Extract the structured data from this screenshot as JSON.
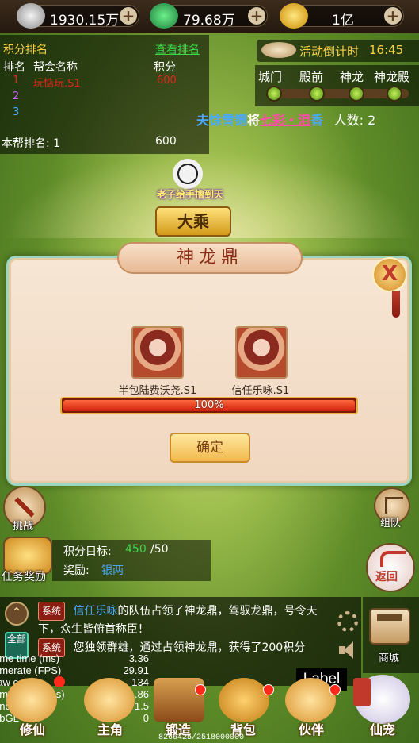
{
  "currency": {
    "silver": "1930.15万",
    "jade": "79.68万",
    "gold": "1亿"
  },
  "rank_panel": {
    "title": "积分排名",
    "view_link": "查看排名",
    "headers": {
      "rank": "排名",
      "name": "帮会名称",
      "score": "积分"
    },
    "rows": [
      {
        "rank": "1",
        "name": "玩惦玩.S1",
        "score": "600"
      },
      {
        "rank": "2",
        "name": "",
        "score": ""
      },
      {
        "rank": "3",
        "name": "",
        "score": ""
      }
    ],
    "my_rank_label": "本帮排名: 1",
    "my_score": "600"
  },
  "countdown": {
    "label": "活动倒计时",
    "time": "16:45"
  },
  "stages": [
    "城门",
    "殿前",
    "神龙",
    "神龙殿"
  ],
  "ticker": {
    "part1": "夫",
    "part2": "馀雪铏",
    "part3": "将",
    "part4": "七彩・泪",
    "part5": "香",
    "people": "人数: 2"
  },
  "guild_banner": {
    "title": "老子给手撸到天",
    "rank": "大乘"
  },
  "dialog": {
    "title": "神龙鼎",
    "players": [
      {
        "name": "半包陆费沃尧.S1"
      },
      {
        "name": "信任乐咏.S1"
      }
    ],
    "progress": {
      "label": "100%",
      "fraction": 1.0
    },
    "confirm_label": "确定",
    "close_glyph": "X"
  },
  "side": {
    "challenge": "挑战",
    "team": "组队",
    "task_reward": "任务奖励",
    "back": "返回",
    "mall": "商城"
  },
  "task": {
    "target_label": "积分目标:",
    "target_current": "450",
    "target_total": "/50",
    "reward_label": "奖励:",
    "reward_value": "银两"
  },
  "chat": {
    "all_tab": "全部",
    "msg1": {
      "tag": "系统",
      "name": "信任乐咏",
      "text": "的队伍占领了神龙鼎，驾驭龙鼎，号令天下，众生皆俯首称臣！"
    },
    "msg2": {
      "tag": "系统",
      "text": "您独领群雄，通过占领神龙鼎，获得了200积分"
    }
  },
  "debug": [
    {
      "key": "ame time (ms)",
      "value": "3.36"
    },
    {
      "key": "amerate (FPS)",
      "value": "29.91"
    },
    {
      "key": "raw call",
      "value": "134"
    },
    {
      "key": "ame Logic (ms)",
      "value": "1.86"
    },
    {
      "key": "enderer (ms)",
      "value": "1.5"
    },
    {
      "key": "ebGL",
      "value": "0"
    }
  ],
  "label_box": "Label",
  "bottom_nav": [
    {
      "label": "修仙",
      "icon": "cultivate-icon"
    },
    {
      "label": "主角",
      "icon": "hero-icon"
    },
    {
      "label": "锻造",
      "icon": "forge-icon"
    },
    {
      "label": "背包",
      "icon": "bag-icon"
    },
    {
      "label": "伙伴",
      "icon": "partner-icon"
    },
    {
      "label": "仙宠",
      "icon": "pet-icon"
    }
  ],
  "footer_score": "8266425/2518000000",
  "colors": {
    "accent": "#d0210f",
    "gold": "#f2b94b",
    "green": "#9bd6c1"
  }
}
